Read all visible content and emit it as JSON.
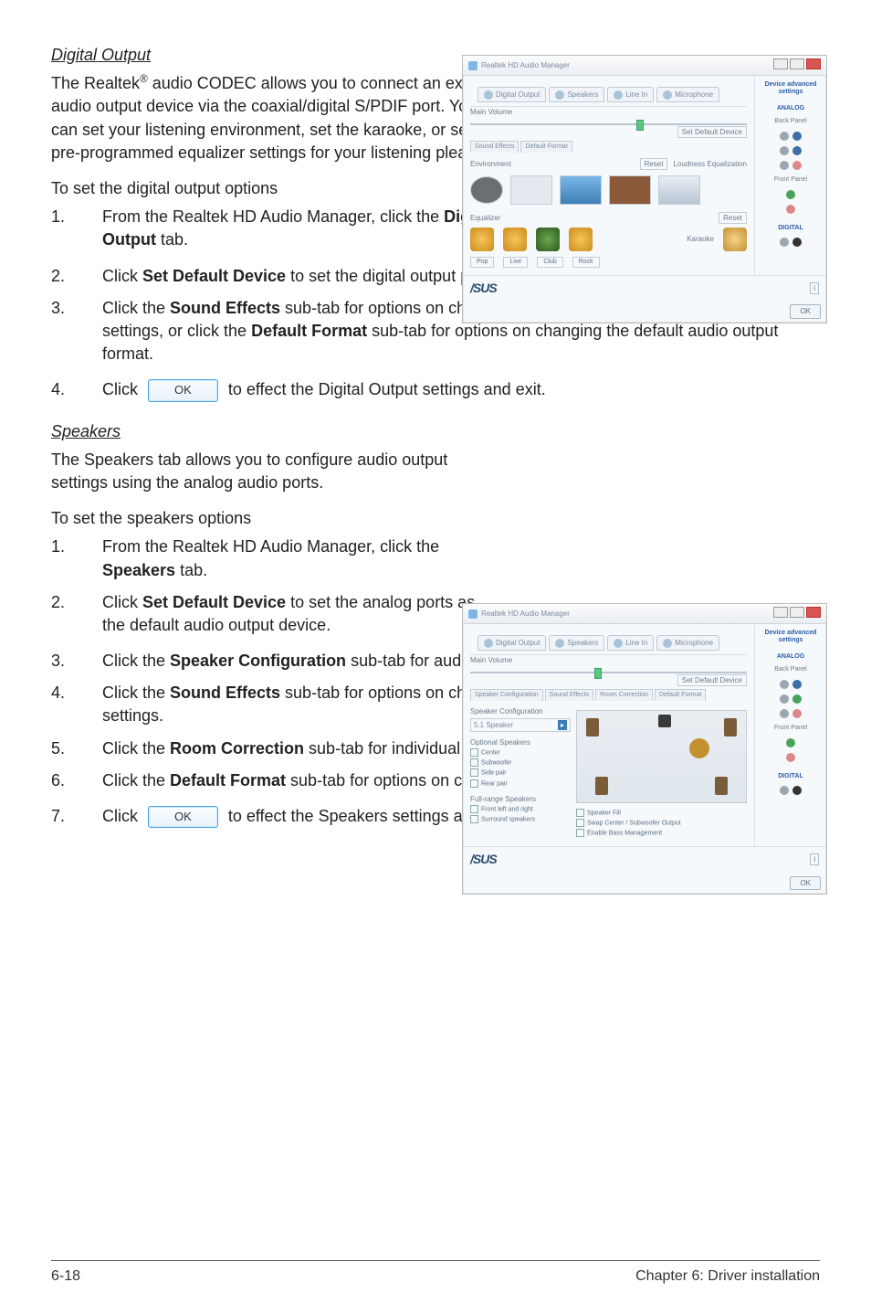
{
  "section1": {
    "heading": "Digital Output",
    "intro_html": "The Realtek<sup>®</sup> audio CODEC allows you to connect an external audio output device via the coaxial/digital S/PDIF port. You can set your listening environment, set the karaoke, or select pre-programmed equalizer settings for your listening pleasure.",
    "lead_in": "To set the digital output options",
    "steps_narrow": [
      "From the Realtek HD Audio Manager, click the <span class=\"bold\">Digital Output</span> tab."
    ],
    "steps_wide": [
      "Click <span class=\"bold\">Set Default Device</span> to set the digital output port as the default audio output device.",
      "Click the <span class=\"bold\">Sound Effects</span> sub-tab for options on changing the acoustic environment and karaoke settings, or click the <span class=\"bold\">Default Format</span> sub-tab for options on changing the default audio output format."
    ],
    "step_ok_prefix": "Click",
    "step_ok_suffix": "to effect the Digital Output settings and exit.",
    "ok_label": "OK"
  },
  "section2": {
    "heading": "Speakers",
    "intro_html": "The <span class=\"bold\">Speakers</span> tab allows you to configure audio output settings using the analog audio ports.",
    "lead_in": "To set the speakers options",
    "steps_narrow": [
      "From the Realtek HD Audio Manager, click the <span class=\"bold\">Speakers</span> tab.",
      "Click <span class=\"bold\">Set Default Device</span> to set the analog ports as the default audio output device."
    ],
    "steps_wide": [
      "Click the <span class=\"bold\">Speaker Configuration</span> sub-tab for audio channel options and test.",
      "Click the <span class=\"bold\">Sound Effects</span> sub-tab for options on changing the acoustic environment and karaoke settings.",
      "Click the <span class=\"bold\">Room Correction</span> sub-tab for individual speaker distance adjustment.",
      "Click the <span class=\"bold\">Default Format</span> sub-tab for options on changing the default audio output format."
    ],
    "step_ok_prefix": "Click",
    "step_ok_suffix": "to effect the Speakers settings and exit.",
    "ok_label": "OK"
  },
  "screenshot_common": {
    "window_title": "Realtek HD Audio Manager",
    "tabs": [
      "Digital Output",
      "Speakers",
      "Line In",
      "Microphone"
    ],
    "main_volume_label": "Main Volume",
    "set_default_label": "Set Default Device",
    "analog_header": "ANALOG",
    "back_panel_label": "Back Panel",
    "front_panel_label": "Front Panel",
    "digital_header": "DIGITAL",
    "asus_logo": "/SUS",
    "ok_chip": "OK"
  },
  "screenshot_digital": {
    "sub_tabs": [
      "Sound Effects",
      "Default Format"
    ],
    "environment_label": "Environment",
    "loudness_label": "Loudness Equalization",
    "reset_label": "Reset",
    "equalizer_label": "Equalizer",
    "karaoke_label": "Karaoke",
    "btn_labels": [
      "Pop",
      "Live",
      "Club",
      "Rock"
    ]
  },
  "screenshot_speakers": {
    "sub_tabs": [
      "Speaker Configuration",
      "Sound Effects",
      "Room Correction",
      "Default Format"
    ],
    "config_label": "Speaker Configuration",
    "config_value": "5.1 Speaker",
    "optional_header": "Optional Speakers",
    "optional_items": [
      "Center",
      "Subwoofer",
      "Side pair",
      "Rear pair"
    ],
    "fullrange_header": "Full-range Speakers",
    "fullrange_items": [
      "Front left and right",
      "Surround speakers"
    ],
    "notes": [
      "Speaker Fill",
      "Swap Center / Subwoofer Output",
      "Enable Bass Management"
    ]
  },
  "footer": {
    "left": "6-18",
    "right": "Chapter 6: Driver installation"
  }
}
